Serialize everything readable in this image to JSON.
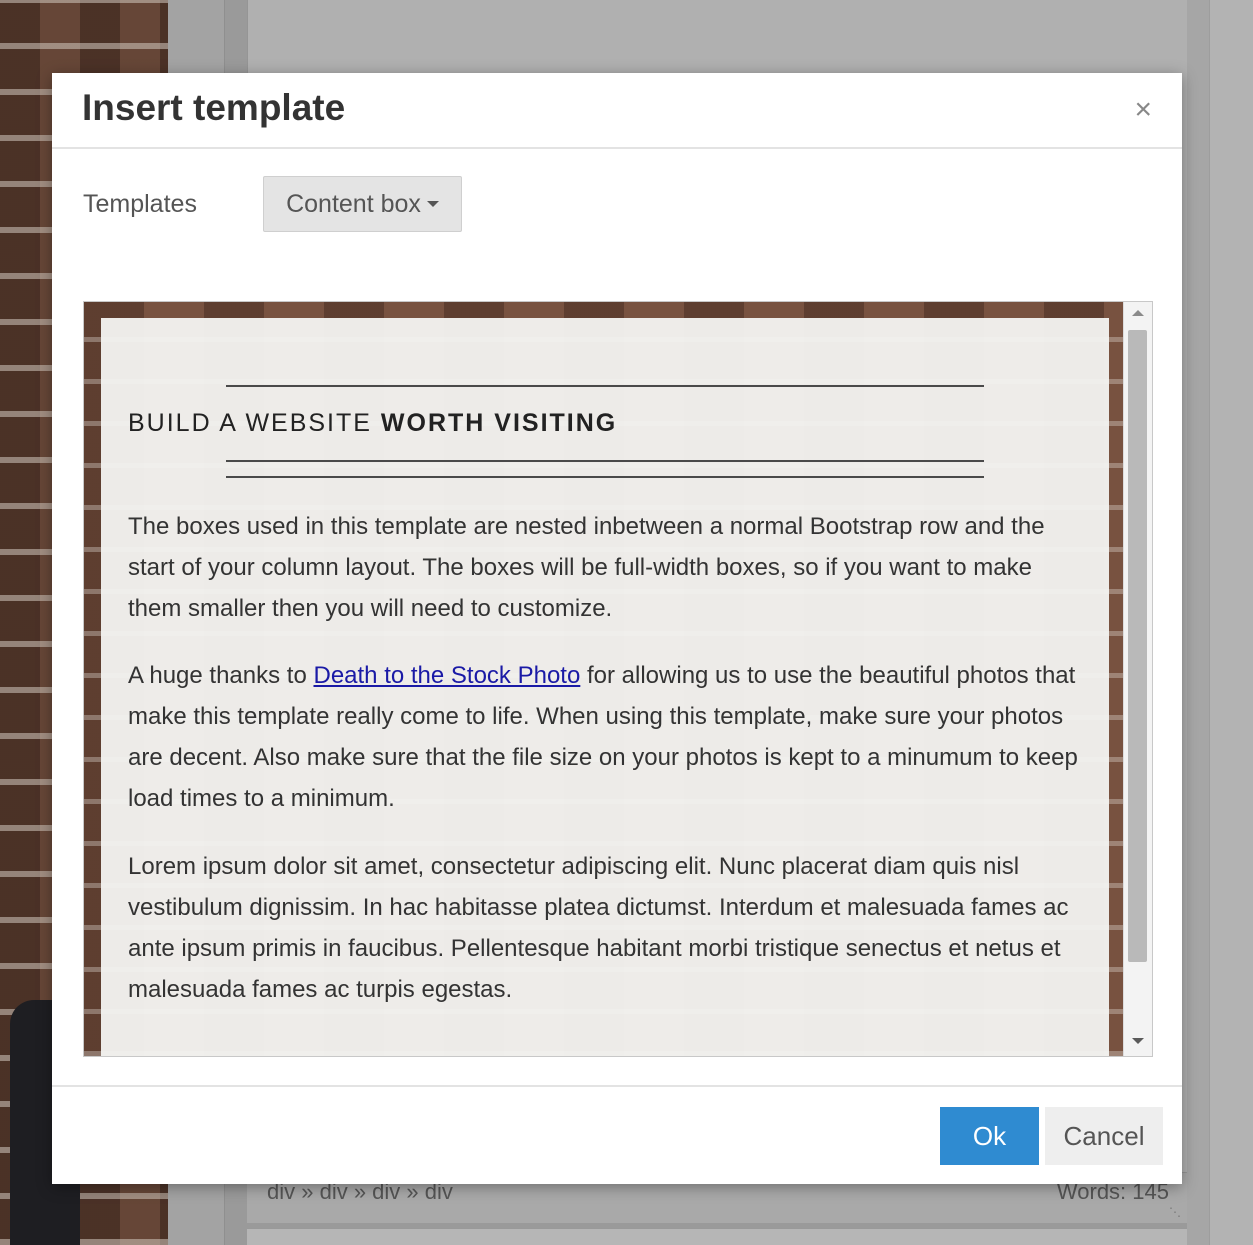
{
  "background": {
    "status_path": "div » div » div » div",
    "status_words": "Words: 145"
  },
  "dialog": {
    "title": "Insert template",
    "close_glyph": "×",
    "templates_label": "Templates",
    "selected_template": "Content box",
    "preview": {
      "heading_light": "BUILD A WEBSITE ",
      "heading_bold": "WORTH VISITING",
      "paragraph1": "The boxes used in this template are nested inbetween a normal Bootstrap row and the start of your column layout. The boxes will be full-width boxes, so if you want to make them smaller then you will need to customize.",
      "paragraph2_before": "A huge thanks to ",
      "paragraph2_link": "Death to the Stock Photo",
      "paragraph2_after": " for allowing us to use the beautiful photos that make this template really come to life. When using this template, make sure your photos are decent. Also make sure that the file size on your photos is kept to a minumum to keep load times to a minimum.",
      "paragraph3": "Lorem ipsum dolor sit amet, consectetur adipiscing elit. Nunc placerat diam quis nisl vestibulum dignissim. In hac habitasse platea dictumst. Interdum et malesuada fames ac ante ipsum primis in faucibus. Pellentesque habitant morbi tristique senectus et netus et malesuada fames ac turpis egestas."
    },
    "ok_label": "Ok",
    "cancel_label": "Cancel"
  },
  "icons": {
    "close": "close-icon",
    "caret": "caret-down-icon",
    "scroll_up": "scroll-up-arrow-icon",
    "scroll_down": "scroll-down-arrow-icon",
    "resize_grip": "resize-grip-icon"
  },
  "colors": {
    "ok_button": "#2f8bd1",
    "link": "#1a1aa6"
  }
}
